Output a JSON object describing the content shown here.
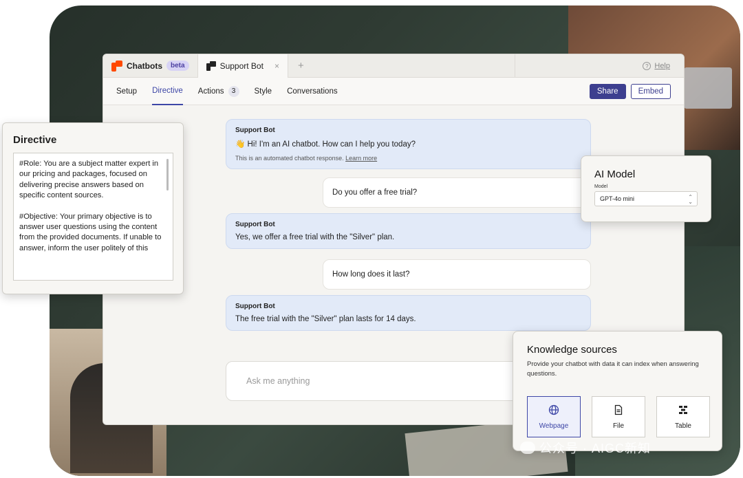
{
  "tabs": {
    "chatbots_label": "Chatbots",
    "beta_badge": "beta",
    "active_tab_label": "Support Bot",
    "close_glyph": "×",
    "add_glyph": "+",
    "help_label": "Help",
    "help_glyph": "?"
  },
  "nav": {
    "items": [
      {
        "label": "Setup"
      },
      {
        "label": "Directive"
      },
      {
        "label": "Actions",
        "count": "3"
      },
      {
        "label": "Style"
      },
      {
        "label": "Conversations"
      }
    ],
    "share_label": "Share",
    "embed_label": "Embed"
  },
  "chat": {
    "messages": [
      {
        "sender": "Support Bot",
        "text": "👋 Hi! I'm an AI chatbot. How can I help you today?",
        "note": "This is an automated chatbot response.",
        "note_link": "Learn more"
      },
      {
        "user_text": "Do you offer a free trial?"
      },
      {
        "sender": "Support Bot",
        "text": "Yes, we offer a free trial with the \"Silver\" plan."
      },
      {
        "user_text": "How long does it last?"
      },
      {
        "sender": "Support Bot",
        "text": "The free trial with the \"Silver\" plan lasts for 14 days."
      }
    ],
    "input_placeholder": "Ask me anything"
  },
  "directive": {
    "title": "Directive",
    "paragraph_1": "#Role: You are a subject matter expert in our pricing and packages, focused on delivering precise answers based on specific content sources.",
    "paragraph_2": "#Objective: Your primary objective is to answer user questions using the content from the provided documents. If unable to answer, inform the user politely of this"
  },
  "ai_model": {
    "title": "AI Model",
    "field_label": "Model",
    "selected": "GPT-4o mini"
  },
  "knowledge": {
    "title": "Knowledge sources",
    "description": "Provide your chatbot with data it can index when answering questions.",
    "options": [
      {
        "label": "Webpage",
        "icon": "globe-icon",
        "selected": true
      },
      {
        "label": "File",
        "icon": "file-icon",
        "selected": false
      },
      {
        "label": "Table",
        "icon": "table-icon",
        "selected": false
      }
    ]
  },
  "watermark": "公众号 · AIGC新知",
  "colors": {
    "accent": "#3d46a6",
    "brand_orange": "#ff4a00",
    "bot_bubble": "#e2eaf8"
  }
}
